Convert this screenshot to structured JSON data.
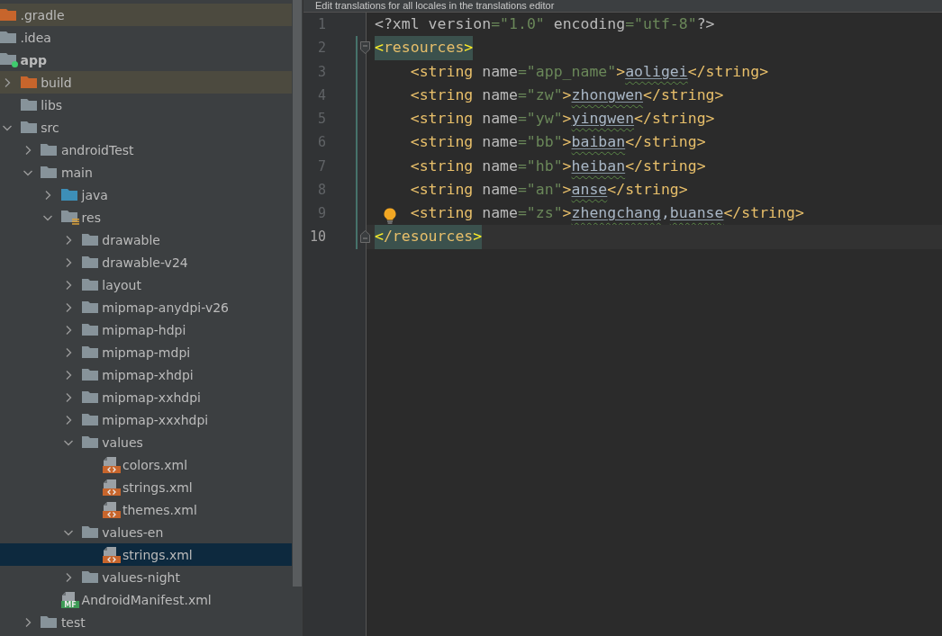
{
  "project_tree": {
    "items": [
      {
        "label": ".gradle",
        "kind": "excluded-folder",
        "selected": false
      },
      {
        "label": ".idea",
        "kind": "folder",
        "selected": false
      },
      {
        "label": "app",
        "kind": "module",
        "selected": false,
        "children": [
          {
            "label": "build",
            "kind": "excluded-folder",
            "expanded": false,
            "selected": false
          },
          {
            "label": "libs",
            "kind": "folder",
            "selected": false
          },
          {
            "label": "src",
            "kind": "folder",
            "expanded": true,
            "selected": false,
            "children": [
              {
                "label": "androidTest",
                "kind": "folder",
                "expanded": false,
                "selected": false
              },
              {
                "label": "main",
                "kind": "folder",
                "expanded": true,
                "selected": false,
                "children": [
                  {
                    "label": "java",
                    "kind": "source-folder",
                    "expanded": false,
                    "selected": false
                  },
                  {
                    "label": "res",
                    "kind": "resource-folder",
                    "expanded": true,
                    "selected": false,
                    "children": [
                      {
                        "label": "drawable",
                        "kind": "folder",
                        "expanded": false,
                        "selected": false
                      },
                      {
                        "label": "drawable-v24",
                        "kind": "folder",
                        "expanded": false,
                        "selected": false
                      },
                      {
                        "label": "layout",
                        "kind": "folder",
                        "expanded": false,
                        "selected": false
                      },
                      {
                        "label": "mipmap-anydpi-v26",
                        "kind": "folder",
                        "expanded": false,
                        "selected": false
                      },
                      {
                        "label": "mipmap-hdpi",
                        "kind": "folder",
                        "expanded": false,
                        "selected": false
                      },
                      {
                        "label": "mipmap-mdpi",
                        "kind": "folder",
                        "expanded": false,
                        "selected": false
                      },
                      {
                        "label": "mipmap-xhdpi",
                        "kind": "folder",
                        "expanded": false,
                        "selected": false
                      },
                      {
                        "label": "mipmap-xxhdpi",
                        "kind": "folder",
                        "expanded": false,
                        "selected": false
                      },
                      {
                        "label": "mipmap-xxxhdpi",
                        "kind": "folder",
                        "expanded": false,
                        "selected": false
                      },
                      {
                        "label": "values",
                        "kind": "folder",
                        "expanded": true,
                        "selected": false,
                        "children": [
                          {
                            "label": "colors.xml",
                            "kind": "xml-file",
                            "selected": false
                          },
                          {
                            "label": "strings.xml",
                            "kind": "xml-file",
                            "selected": false
                          },
                          {
                            "label": "themes.xml",
                            "kind": "xml-file",
                            "selected": false
                          }
                        ]
                      },
                      {
                        "label": "values-en",
                        "kind": "folder",
                        "expanded": true,
                        "selected": false,
                        "children": [
                          {
                            "label": "strings.xml",
                            "kind": "xml-file",
                            "selected": true
                          }
                        ]
                      },
                      {
                        "label": "values-night",
                        "kind": "folder",
                        "expanded": false,
                        "selected": false
                      }
                    ]
                  },
                  {
                    "label": "AndroidManifest.xml",
                    "kind": "manifest-file",
                    "icon_text": "MF",
                    "selected": false
                  }
                ]
              },
              {
                "label": "test",
                "kind": "folder",
                "expanded": false,
                "selected": false
              }
            ]
          }
        ]
      }
    ]
  },
  "editor": {
    "banner": "Edit translations for all locales in the translations editor",
    "lines": [
      {
        "number": "1",
        "current": false,
        "bulb": false,
        "tag_match": false,
        "fold_start": false,
        "fold_end": false,
        "tokens": [
          {
            "kind": "prolog",
            "text": "<?xml"
          },
          {
            "kind": "attr",
            "text": " version"
          },
          {
            "kind": "value",
            "text": "=\"1.0\""
          },
          {
            "kind": "attr",
            "text": " encoding"
          },
          {
            "kind": "value",
            "text": "=\"utf-8\""
          },
          {
            "kind": "prolog",
            "text": "?>"
          }
        ]
      },
      {
        "number": "2",
        "current": false,
        "bulb": false,
        "tag_match": true,
        "fold_start": true,
        "fold_end": false,
        "tokens": [
          {
            "kind": "match",
            "text": "<"
          },
          {
            "kind": "tag",
            "text": "resources"
          },
          {
            "kind": "match",
            "text": ">"
          }
        ],
        "children": [
          {
            "number": "3",
            "current": false,
            "bulb": false,
            "tag_match": false,
            "fold_start": false,
            "fold_end": false,
            "tokens": [
              {
                "kind": "tag",
                "text": "<string"
              },
              {
                "kind": "attr",
                "text": " name"
              },
              {
                "kind": "value",
                "text": "=\"app_name\""
              },
              {
                "kind": "tag",
                "text": ">"
              },
              {
                "kind": "text",
                "text": "aoligei"
              },
              {
                "kind": "tag",
                "text": "</string>"
              }
            ]
          },
          {
            "number": "4",
            "current": false,
            "bulb": false,
            "tag_match": false,
            "fold_start": false,
            "fold_end": false,
            "tokens": [
              {
                "kind": "tag",
                "text": "<string"
              },
              {
                "kind": "attr",
                "text": " name"
              },
              {
                "kind": "value",
                "text": "=\"zw\""
              },
              {
                "kind": "tag",
                "text": ">"
              },
              {
                "kind": "text",
                "text": "zhongwen"
              },
              {
                "kind": "tag",
                "text": "</string>"
              }
            ]
          },
          {
            "number": "5",
            "current": false,
            "bulb": false,
            "tag_match": false,
            "fold_start": false,
            "fold_end": false,
            "tokens": [
              {
                "kind": "tag",
                "text": "<string"
              },
              {
                "kind": "attr",
                "text": " name"
              },
              {
                "kind": "value",
                "text": "=\"yw\""
              },
              {
                "kind": "tag",
                "text": ">"
              },
              {
                "kind": "text",
                "text": "yingwen"
              },
              {
                "kind": "tag",
                "text": "</string>"
              }
            ]
          },
          {
            "number": "6",
            "current": false,
            "bulb": false,
            "tag_match": false,
            "fold_start": false,
            "fold_end": false,
            "tokens": [
              {
                "kind": "tag",
                "text": "<string"
              },
              {
                "kind": "attr",
                "text": " name"
              },
              {
                "kind": "value",
                "text": "=\"bb\""
              },
              {
                "kind": "tag",
                "text": ">"
              },
              {
                "kind": "text",
                "text": "baiban"
              },
              {
                "kind": "tag",
                "text": "</string>"
              }
            ]
          },
          {
            "number": "7",
            "current": false,
            "bulb": false,
            "tag_match": false,
            "fold_start": false,
            "fold_end": false,
            "tokens": [
              {
                "kind": "tag",
                "text": "<string"
              },
              {
                "kind": "attr",
                "text": " name"
              },
              {
                "kind": "value",
                "text": "=\"hb\""
              },
              {
                "kind": "tag",
                "text": ">"
              },
              {
                "kind": "text",
                "text": "heiban"
              },
              {
                "kind": "tag",
                "text": "</string>"
              }
            ]
          },
          {
            "number": "8",
            "current": false,
            "bulb": false,
            "tag_match": false,
            "fold_start": false,
            "fold_end": false,
            "tokens": [
              {
                "kind": "tag",
                "text": "<string"
              },
              {
                "kind": "attr",
                "text": " name"
              },
              {
                "kind": "value",
                "text": "=\"an\""
              },
              {
                "kind": "tag",
                "text": ">"
              },
              {
                "kind": "text",
                "text": "anse"
              },
              {
                "kind": "tag",
                "text": "</string>"
              }
            ]
          },
          {
            "number": "9",
            "current": false,
            "bulb": true,
            "tag_match": false,
            "fold_start": false,
            "fold_end": false,
            "tokens": [
              {
                "kind": "tag",
                "text": "<string"
              },
              {
                "kind": "attr",
                "text": " name"
              },
              {
                "kind": "value",
                "text": "=\"zs\""
              },
              {
                "kind": "tag",
                "text": ">"
              },
              {
                "kind": "text",
                "text": "zhengchang"
              },
              {
                "kind": "punct",
                "text": ","
              },
              {
                "kind": "text",
                "text": "buanse"
              },
              {
                "kind": "tag",
                "text": "</string>"
              }
            ]
          }
        ]
      },
      {
        "number": "10",
        "current": true,
        "bulb": false,
        "tag_match": true,
        "fold_start": false,
        "fold_end": true,
        "tokens": [
          {
            "kind": "match",
            "text": "<"
          },
          {
            "kind": "tag",
            "text": "/resources"
          },
          {
            "kind": "match",
            "text": ">"
          }
        ]
      }
    ]
  }
}
